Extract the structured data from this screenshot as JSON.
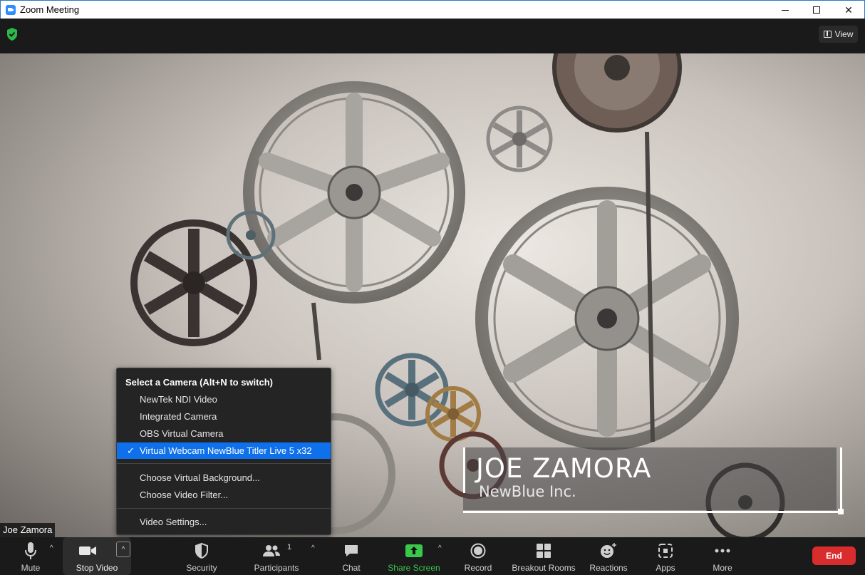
{
  "window": {
    "title": "Zoom Meeting"
  },
  "topbar": {
    "view_label": "View"
  },
  "video": {
    "participant_name": "Joe Zamora",
    "lower_third": {
      "name": "JOE ZAMORA",
      "company": "NewBlue Inc."
    }
  },
  "camera_menu": {
    "header": "Select a Camera (Alt+N to switch)",
    "cameras": [
      {
        "label": "NewTek NDI Video",
        "selected": false
      },
      {
        "label": "Integrated Camera",
        "selected": false
      },
      {
        "label": "OBS Virtual Camera",
        "selected": false
      },
      {
        "label": "Virtual Webcam NewBlue Titler Live 5 x32",
        "selected": true
      }
    ],
    "check_mark": "✓",
    "options": [
      "Choose Virtual Background...",
      "Choose Video Filter..."
    ],
    "settings": "Video Settings..."
  },
  "toolbar": {
    "mute": "Mute",
    "stop_video": "Stop Video",
    "security": "Security",
    "participants": "Participants",
    "participants_count": "1",
    "chat": "Chat",
    "share_screen": "Share Screen",
    "record": "Record",
    "breakout_rooms": "Breakout Rooms",
    "reactions": "Reactions",
    "apps": "Apps",
    "more": "More",
    "end": "End"
  },
  "colors": {
    "accent": "#0e71eb",
    "share_green": "#39c84a",
    "end_red": "#d92c2c",
    "shield_green": "#2fb84a"
  }
}
